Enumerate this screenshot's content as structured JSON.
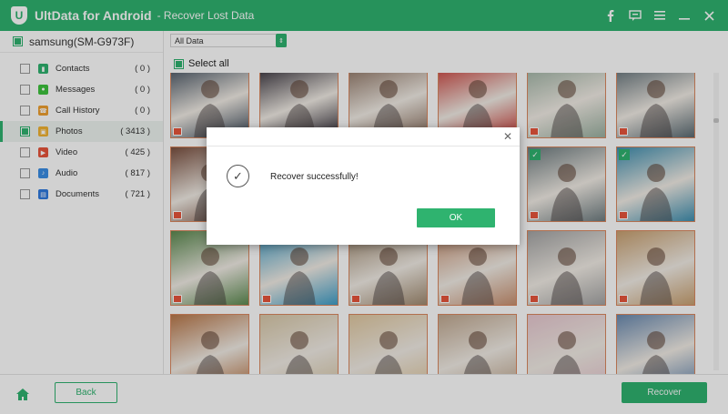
{
  "app": {
    "title": "UltData for Android",
    "subtitle": "- Recover Lost Data",
    "logo_letter": "U",
    "brand_color": "#2fb36f"
  },
  "titlebar_icons": [
    "facebook-icon",
    "feedback-icon",
    "menu-icon",
    "minimize-icon",
    "close-icon"
  ],
  "sidebar": {
    "device": "samsung(SM-G973F)",
    "categories": [
      {
        "label": "Contacts",
        "count": "( 0 )",
        "icon": "contacts-icon",
        "color": "#2fb36f",
        "checked": false
      },
      {
        "label": "Messages",
        "count": "( 0 )",
        "icon": "messages-icon",
        "color": "#3ec43e",
        "checked": false
      },
      {
        "label": "Call History",
        "count": "( 0 )",
        "icon": "call-history-icon",
        "color": "#f0a030",
        "checked": false
      },
      {
        "label": "Photos",
        "count": "( 3413 )",
        "icon": "photos-icon",
        "color": "#f2b230",
        "checked": true
      },
      {
        "label": "Video",
        "count": "( 425 )",
        "icon": "video-icon",
        "color": "#e8553b",
        "checked": false
      },
      {
        "label": "Audio",
        "count": "( 817 )",
        "icon": "audio-icon",
        "color": "#3a8ee6",
        "checked": false
      },
      {
        "label": "Documents",
        "count": "( 721 )",
        "icon": "documents-icon",
        "color": "#2f7ae0",
        "checked": false
      }
    ]
  },
  "main": {
    "filter_value": "All Data",
    "select_all_label": "Select all"
  },
  "photos": {
    "checked_indices": [
      10,
      11
    ],
    "colors": [
      "#3c4a5a",
      "#2a2530",
      "#8a6f5e",
      "#c83a35",
      "#9ab0a0",
      "#5a6a72",
      "#7a5040",
      "#1e2a3a",
      "#2c3340",
      "#b07850",
      "#6e7c80",
      "#3f8fb0",
      "#5c8a50",
      "#3f9ec8",
      "#a08a70",
      "#c89070",
      "#a4a4a4",
      "#c8a070",
      "#b9784a",
      "#d8c8a8",
      "#e0c8a0",
      "#c0a890",
      "#e8c8d0",
      "#6a8ab0"
    ]
  },
  "footer": {
    "back_label": "Back",
    "recover_label": "Recover"
  },
  "dialog": {
    "message": "Recover successfully!",
    "ok_label": "OK"
  }
}
